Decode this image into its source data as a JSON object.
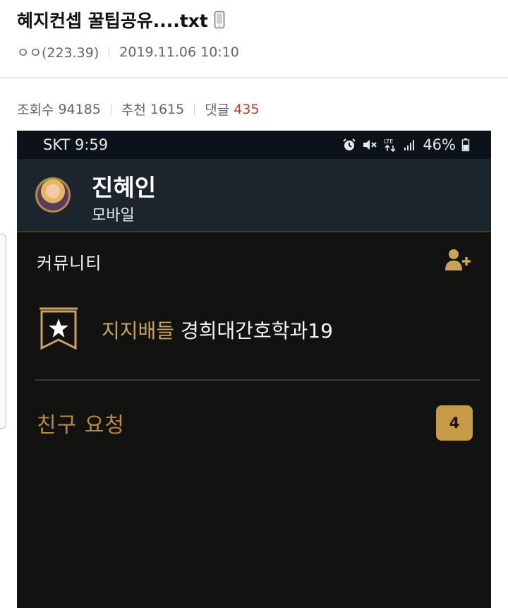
{
  "post": {
    "title": "혜지컨셉 꿀팁공유....txt",
    "title_icon": "mobile-phone-icon",
    "author": "ㅇㅇ(223.39)",
    "datetime": "2019.11.06 10:10",
    "stats": {
      "views_label": "조회수",
      "views": "94185",
      "recommend_label": "추천",
      "recommend": "1615",
      "comments_label": "댓글",
      "comments": "435"
    }
  },
  "screenshot": {
    "status_bar": {
      "carrier_time": "SKT 9:59",
      "battery": "46%",
      "icons": [
        "alarm-icon",
        "mute-icon",
        "lte-icon",
        "signal-icon",
        "battery-icon"
      ]
    },
    "profile": {
      "name": "진혜인",
      "subtitle": "모바일"
    },
    "community": {
      "label": "커뮤니티",
      "add_icon": "add-friend-icon",
      "clan_prefix": "지지배들",
      "clan_name": "경희대간호학과19"
    },
    "friend_request": {
      "label": "친구 요청",
      "count": "4"
    }
  },
  "colors": {
    "gold": "#c9a35a",
    "dark_bg": "#121211",
    "header_bg": "#1c252e",
    "comment_count": "#c0392b"
  }
}
